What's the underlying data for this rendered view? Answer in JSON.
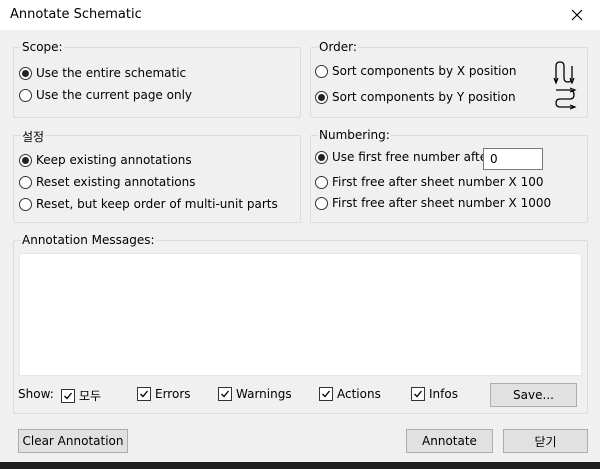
{
  "window": {
    "title": "Annotate Schematic"
  },
  "scope": {
    "label": "Scope:",
    "options": [
      {
        "label": "Use the entire schematic",
        "selected": true
      },
      {
        "label": "Use the current page only",
        "selected": false
      }
    ]
  },
  "order": {
    "label": "Order:",
    "options": [
      {
        "label": "Sort components by X position",
        "selected": false,
        "icon": "sort-x-icon"
      },
      {
        "label": "Sort components by Y position",
        "selected": true,
        "icon": "sort-y-icon"
      }
    ]
  },
  "settings": {
    "label": "설정",
    "options": [
      {
        "label": "Keep existing annotations",
        "selected": true
      },
      {
        "label": "Reset existing annotations",
        "selected": false
      },
      {
        "label": "Reset, but keep order of multi-unit parts",
        "selected": false
      }
    ]
  },
  "numbering": {
    "label": "Numbering:",
    "options": [
      {
        "label": "Use first free number after:",
        "selected": true
      },
      {
        "label": "First free after sheet number X 100",
        "selected": false
      },
      {
        "label": "First free after sheet number X 1000",
        "selected": false
      }
    ],
    "first_free_value": "0"
  },
  "messages": {
    "label": "Annotation Messages:",
    "show_label": "Show:",
    "filters": [
      {
        "label": "모두",
        "checked": true
      },
      {
        "label": "Errors",
        "checked": true
      },
      {
        "label": "Warnings",
        "checked": true
      },
      {
        "label": "Actions",
        "checked": true
      },
      {
        "label": "Infos",
        "checked": true
      }
    ],
    "save_label": "Save..."
  },
  "footer": {
    "clear_label": "Clear Annotation",
    "annotate_label": "Annotate",
    "close_label": "닫기"
  }
}
